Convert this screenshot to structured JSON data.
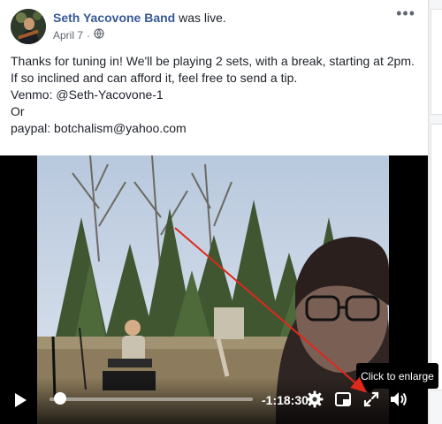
{
  "post": {
    "page_name": "Seth Yacovone Band",
    "action": " was live.",
    "date": "April 7",
    "audience_icon": "globe-icon",
    "more_icon": "more-options-icon",
    "more_label": "•••"
  },
  "body_lines": [
    "Thanks for tuning in! We'll be playing 2 sets, with a break, starting at 2pm.",
    "If so inclined and can afford it, feel free to send a tip.",
    "Venmo: @Seth-Yacovone-1",
    "Or",
    "paypal: botchalism@yahoo.com"
  ],
  "video": {
    "time_remaining": "-1:18:30",
    "progress": 0.02,
    "tooltip": "Click to enlarge",
    "controls": [
      "play-icon",
      "settings-gear-icon",
      "picture-in-picture-icon",
      "fullscreen-expand-icon",
      "volume-icon"
    ]
  },
  "colors": {
    "link": "#385898",
    "annotation_arrow": "#e0281b",
    "text": "#1d2129"
  }
}
